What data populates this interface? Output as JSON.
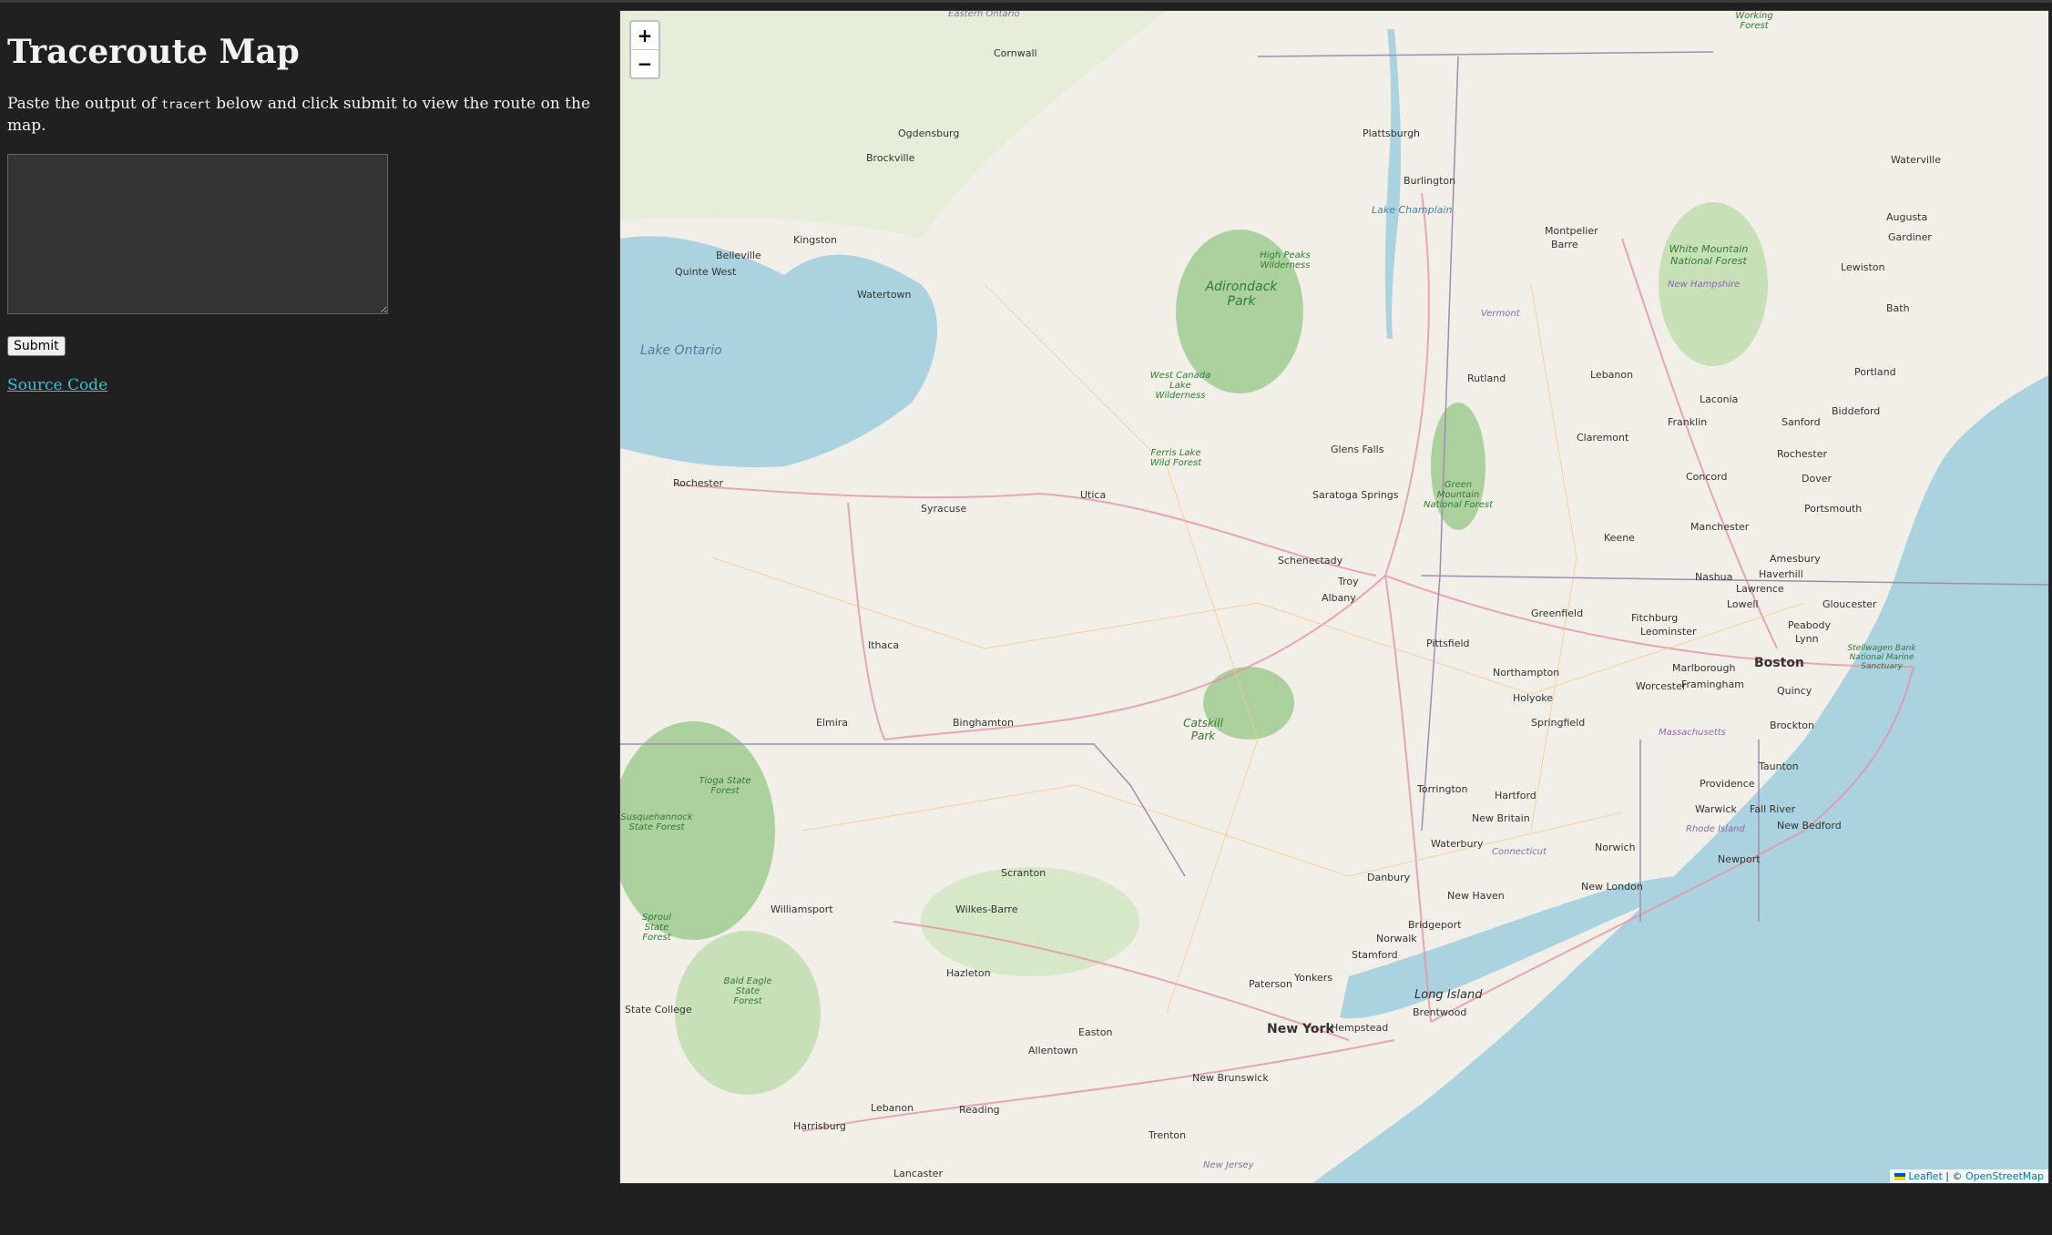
{
  "page": {
    "title": "Traceroute Map",
    "intro_before": "Paste the output of ",
    "intro_code": "tracert",
    "intro_after": " below and click submit to view the route on the map.",
    "textarea_value": "",
    "submit_label": "Submit",
    "source_link": "Source Code"
  },
  "map": {
    "zoom_in": "+",
    "zoom_out": "−",
    "attribution": {
      "leaflet": "Leaflet",
      "separator": " | © ",
      "osm": "OpenStreetMap"
    },
    "labels": {
      "ogdensburg": "Ogdensburg",
      "brockville": "Brockville",
      "kingston": "Kingston",
      "belleville": "Belleville",
      "quinte_west": "Quinte West",
      "watertown": "Watertown",
      "cornwall": "Cornwall",
      "plattsburgh": "Plattsburgh",
      "burlington": "Burlington",
      "montpelier": "Montpelier",
      "barre": "Barre",
      "rochester": "Rochester",
      "syracuse": "Syracuse",
      "utica": "Utica",
      "ithaca": "Ithaca",
      "elmira": "Elmira",
      "binghamton": "Binghamton",
      "scranton": "Scranton",
      "wilkes_barre": "Wilkes-Barre",
      "williamsport": "Williamsport",
      "hazleton": "Hazleton",
      "state_college": "State College",
      "allentown": "Allentown",
      "easton": "Easton",
      "reading": "Reading",
      "lebanon_pa": "Lebanon",
      "harrisburg": "Harrisburg",
      "lancaster": "Lancaster",
      "trenton": "Trenton",
      "new_brunswick": "New Brunswick",
      "new_york": "New York",
      "yonkers": "Yonkers",
      "paterson": "Paterson",
      "stamford": "Stamford",
      "norwalk": "Norwalk",
      "bridgeport": "Bridgeport",
      "new_haven": "New Haven",
      "waterbury": "Waterbury",
      "danbury": "Danbury",
      "hartford": "Hartford",
      "new_britain": "New Britain",
      "torrington": "Torrington",
      "norwich": "Norwich",
      "new_london": "New London",
      "providence": "Providence",
      "warwick": "Warwick",
      "newport": "Newport",
      "fall_river": "Fall River",
      "new_bedford": "New Bedford",
      "taunton": "Taunton",
      "brockton": "Brockton",
      "quincy": "Quincy",
      "boston": "Boston",
      "worcester": "Worcester",
      "framingham": "Framingham",
      "marlborough": "Marlborough",
      "leominster": "Leominster",
      "fitchburg": "Fitchburg",
      "lowell": "Lowell",
      "lawrence": "Lawrence",
      "haverhill": "Haverhill",
      "nashua": "Nashua",
      "manchester": "Manchester",
      "concord": "Concord",
      "amesbury": "Amesbury",
      "peabody": "Peabody",
      "lynn": "Lynn",
      "gloucester": "Gloucester",
      "portsmouth": "Portsmouth",
      "dover": "Dover",
      "rochester_nh": "Rochester",
      "sanford": "Sanford",
      "biddeford": "Biddeford",
      "portland": "Portland",
      "laconia": "Laconia",
      "franklin": "Franklin",
      "claremont": "Claremont",
      "lebanon_nh": "Lebanon",
      "keene": "Keene",
      "greenfield": "Greenfield",
      "northampton": "Northampton",
      "holyoke": "Holyoke",
      "springfield": "Springfield",
      "pittsfield": "Pittsfield",
      "albany": "Albany",
      "troy": "Troy",
      "schenectady": "Schenectady",
      "saratoga": "Saratoga Springs",
      "glens_falls": "Glens Falls",
      "rutland": "Rutland",
      "lewiston": "Lewiston",
      "bath": "Bath",
      "augusta": "Augusta",
      "gardiner": "Gardiner",
      "waterville": "Waterville",
      "brentwood": "Brentwood",
      "hempstead": "Hempstead",
      "long_island": "Long Island",
      "lake_ontario": "Lake Ontario",
      "lake_champlain": "Lake Champlain",
      "adirondack": "Adirondack Park",
      "high_peaks": "High Peaks Wilderness",
      "west_canada": "West Canada Lake Wilderness",
      "ferris_lake": "Ferris Lake Wild Forest",
      "catskill": "Catskill Park",
      "green_mountain": "Green Mountain National Forest",
      "white_mountain": "White Mountain National Forest",
      "new_hampshire": "New Hampshire",
      "vermont": "Vermont",
      "massachusetts": "Massachusetts",
      "connecticut": "Connecticut",
      "rhode_island": "Rhode Island",
      "new_jersey": "New Jersey",
      "stellwagen": "Stellwagen Bank National Marine Sanctuary",
      "tioga": "Tioga State Forest",
      "susquehannock": "Susquehannock State Forest",
      "sproul": "Sproul State Forest",
      "bald_eagle": "Bald Eagle State Forest",
      "working_forest": "Working Forest",
      "eastern_ontario": "Eastern Ontario"
    }
  }
}
